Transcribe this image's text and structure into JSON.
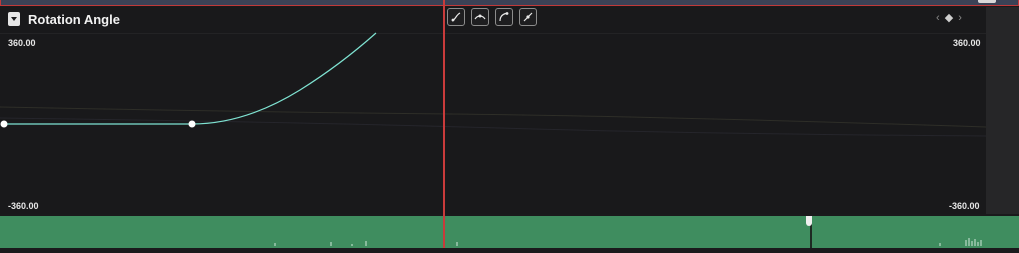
{
  "graph": {
    "title": "Rotation Angle",
    "y_max_label_left": "360.00",
    "y_max_label_right": "360.00",
    "y_min_label_left": "-360.00",
    "y_min_label_right": "-360.00"
  },
  "toolbar": {
    "icons": [
      "ease-in-curve-icon",
      "smooth-keyframe-icon",
      "ease-out-curve-icon",
      "linear-keyframe-icon"
    ]
  },
  "colors": {
    "curve": "#7fe3d2",
    "playhead": "#c93b3b",
    "audio_clip": "#3f8d5f",
    "panel_bg": "#19191b"
  }
}
